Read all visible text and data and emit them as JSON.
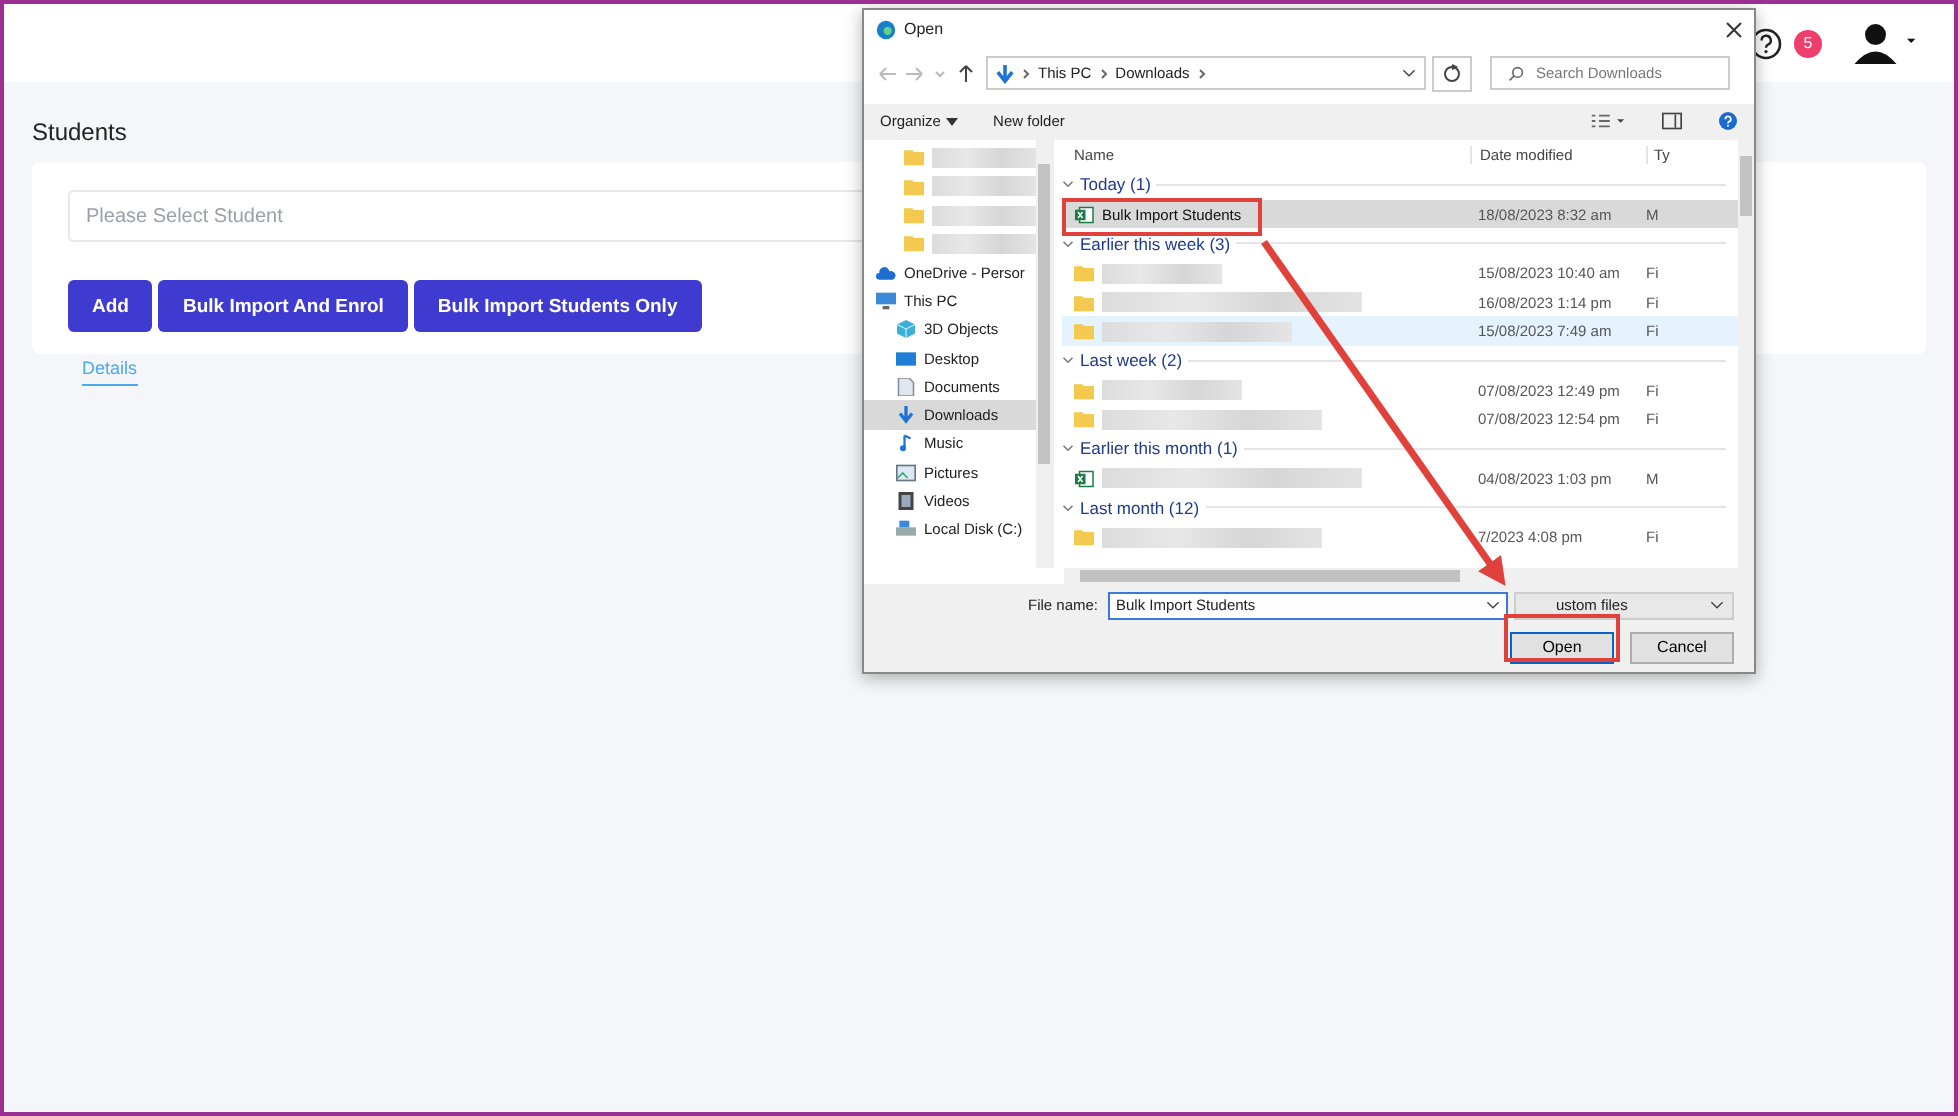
{
  "header": {
    "notification_count": "5"
  },
  "page": {
    "title": "Students",
    "select": {
      "placeholder": "Please Select Student"
    },
    "buttons": [
      "Add",
      "Bulk Import And Enrol",
      "Bulk Import Students Only"
    ],
    "tabs": [
      {
        "label": "Details",
        "selected": true
      }
    ]
  },
  "dialog": {
    "title": "Open",
    "address": [
      "This PC",
      "Downloads"
    ],
    "search_placeholder": "Search Downloads",
    "toolbar": {
      "organize": "Organize",
      "new_folder": "New folder"
    },
    "nav": [
      {
        "kind": "folder"
      },
      {
        "kind": "folder"
      },
      {
        "kind": "folder"
      },
      {
        "kind": "folder"
      },
      {
        "kind": "cloud",
        "label": "OneDrive - Persor",
        "selected": false
      },
      {
        "kind": "pc",
        "label": "This PC",
        "selected": false,
        "children": [
          {
            "kind": "objects",
            "label": "3D Objects",
            "selected": false
          },
          {
            "kind": "desktop",
            "label": "Desktop",
            "selected": false
          },
          {
            "kind": "documents",
            "label": "Documents",
            "selected": false
          },
          {
            "kind": "downloads",
            "label": "Downloads",
            "selected": true
          },
          {
            "kind": "music",
            "label": "Music",
            "selected": false
          },
          {
            "kind": "pictures",
            "label": "Pictures",
            "selected": false
          },
          {
            "kind": "videos",
            "label": "Videos",
            "selected": false
          },
          {
            "kind": "disk",
            "label": "Local Disk (C:)",
            "selected": false
          }
        ]
      }
    ],
    "columns": [
      "Name",
      "Date modified",
      "Ty"
    ],
    "groups": [
      {
        "heading": "Today (1)",
        "files": [
          {
            "kind": "excel",
            "name": "Bulk Import Students",
            "date": "18/08/2023 8:32 am",
            "type": "M",
            "selected": true,
            "hover": false
          }
        ]
      },
      {
        "heading": "Earlier this week (3)",
        "files": [
          {
            "kind": "folder",
            "date": "15/08/2023 10:40 am",
            "type": "Fi",
            "selected": false,
            "hover": false
          },
          {
            "kind": "folder",
            "date": "16/08/2023 1:14 pm",
            "type": "Fi",
            "selected": false,
            "hover": false
          },
          {
            "kind": "folder",
            "date": "15/08/2023 7:49 am",
            "type": "Fi",
            "selected": false,
            "hover": true
          }
        ]
      },
      {
        "heading": "Last week (2)",
        "files": [
          {
            "kind": "folder",
            "date": "07/08/2023 12:49 pm",
            "type": "Fi",
            "selected": false,
            "hover": false
          },
          {
            "kind": "folder",
            "date": "07/08/2023 12:54 pm",
            "type": "Fi",
            "selected": false,
            "hover": false
          }
        ]
      },
      {
        "heading": "Earlier this month (1)",
        "files": [
          {
            "kind": "excel",
            "date": "04/08/2023 1:03 pm",
            "type": "M",
            "selected": false,
            "hover": false
          }
        ]
      },
      {
        "heading": "Last month (12)",
        "files": [
          {
            "kind": "folder",
            "date": "7/2023 4:08 pm",
            "type": "Fi",
            "selected": false,
            "hover": false
          }
        ]
      }
    ],
    "file_name_label": "File name:",
    "file_name": "Bulk Import Students",
    "file_type": "ustom files",
    "buttons": [
      {
        "label": "Open",
        "kind": "primary"
      },
      {
        "label": "Cancel",
        "kind": "secondary"
      }
    ]
  }
}
